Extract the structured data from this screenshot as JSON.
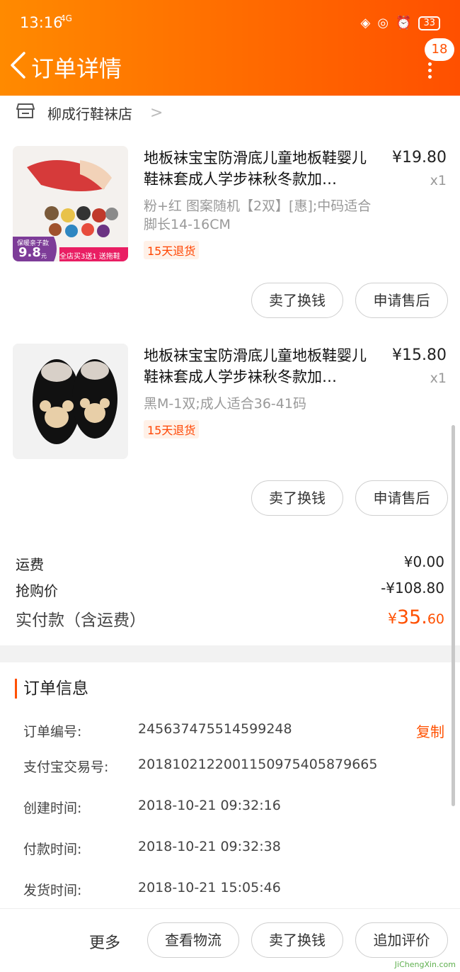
{
  "status": {
    "time": "13:16",
    "network": "4G",
    "battery": "33"
  },
  "header": {
    "title": "订单详情",
    "badge": "18"
  },
  "shop": {
    "name": "柳成行鞋袜店"
  },
  "items": [
    {
      "title": "地板袜宝宝防滑底儿童地板鞋婴儿鞋袜套成人学步袜秋冬款加…",
      "price": "¥19.80",
      "qty": "x1",
      "spec": "粉+红 图案随机【2双】[惠];中码适合脚长14-16CM",
      "tag": "15天退货",
      "thumb_labels": {
        "promo_top": "保暖亲子款",
        "promo_price": "9.8",
        "promo_unit": "元",
        "promo_right": "全店买3送1 送拖鞋"
      },
      "buttons": [
        "卖了换钱",
        "申请售后"
      ]
    },
    {
      "title": "地板袜宝宝防滑底儿童地板鞋婴儿鞋袜套成人学步袜秋冬款加…",
      "price": "¥15.80",
      "qty": "x1",
      "spec": "黑M-1双;成人适合36-41码",
      "tag": "15天退货",
      "buttons": [
        "卖了换钱",
        "申请售后"
      ]
    }
  ],
  "summary": {
    "shipping_label": "运费",
    "shipping_value": "¥0.00",
    "discount_label": "抢购价",
    "discount_value": "-¥108.80",
    "paid_label": "实付款（含运费）",
    "paid_currency": "¥",
    "paid_int": "35.",
    "paid_dec": "60"
  },
  "order_info": {
    "title": "订单信息",
    "copy": "复制",
    "rows": [
      {
        "label": "订单编号:",
        "value": "245637475514599248"
      },
      {
        "label": "支付宝交易号:",
        "value": "2018102122001150975405879665"
      },
      {
        "label": "创建时间:",
        "value": "2018-10-21 09:32:16"
      },
      {
        "label": "付款时间:",
        "value": "2018-10-21 09:32:38"
      },
      {
        "label": "发货时间:",
        "value": "2018-10-21 15:05:46"
      }
    ]
  },
  "bottom": {
    "more": "更多",
    "buttons": [
      "查看物流",
      "卖了换钱",
      "追加评价"
    ]
  },
  "watermark": "JiChengXin.com",
  "colors": {
    "accent": "#ff5000",
    "header_start": "#ff8a00"
  },
  "icons": [
    "back-arrow-icon",
    "more-dots-icon",
    "shop-icon",
    "chevron-right-icon"
  ]
}
